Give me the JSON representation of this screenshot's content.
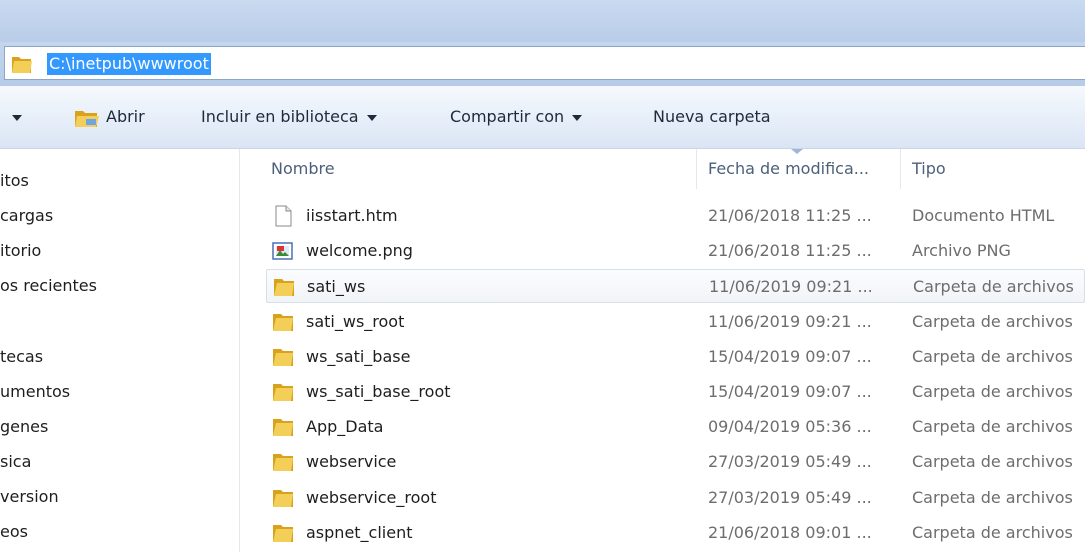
{
  "address": {
    "path": "C:\\inetpub\\wwwroot"
  },
  "toolbar": {
    "open_label": "Abrir",
    "include_label": "Incluir en biblioteca",
    "share_label": "Compartir con",
    "new_folder_label": "Nueva carpeta"
  },
  "nav": {
    "items": [
      "itos",
      "cargas",
      "itorio",
      "os recientes",
      "tecas",
      "umentos",
      "genes",
      "sica",
      "version",
      "eos"
    ]
  },
  "columns": {
    "name": "Nombre",
    "date": "Fecha de modifica...",
    "type": "Tipo"
  },
  "files": [
    {
      "icon": "document-icon",
      "name": "iisstart.htm",
      "date": "21/06/2018 11:25 ...",
      "type": "Documento HTML"
    },
    {
      "icon": "image-icon",
      "name": "welcome.png",
      "date": "21/06/2018 11:25 ...",
      "type": "Archivo PNG"
    },
    {
      "icon": "folder-icon",
      "name": "sati_ws",
      "date": "11/06/2019 09:21 ...",
      "type": "Carpeta de archivos"
    },
    {
      "icon": "folder-icon",
      "name": "sati_ws_root",
      "date": "11/06/2019 09:21 ...",
      "type": "Carpeta de archivos"
    },
    {
      "icon": "folder-icon",
      "name": "ws_sati_base",
      "date": "15/04/2019 09:07 ...",
      "type": "Carpeta de archivos"
    },
    {
      "icon": "folder-icon",
      "name": "ws_sati_base_root",
      "date": "15/04/2019 09:07 ...",
      "type": "Carpeta de archivos"
    },
    {
      "icon": "folder-icon",
      "name": "App_Data",
      "date": "09/04/2019 05:36 ...",
      "type": "Carpeta de archivos"
    },
    {
      "icon": "folder-icon",
      "name": "webservice",
      "date": "27/03/2019 05:49 ...",
      "type": "Carpeta de archivos"
    },
    {
      "icon": "folder-icon",
      "name": "webservice_root",
      "date": "27/03/2019 05:49 ...",
      "type": "Carpeta de archivos"
    },
    {
      "icon": "folder-icon",
      "name": "aspnet_client",
      "date": "21/06/2018 09:01 ...",
      "type": "Carpeta de archivos"
    }
  ],
  "colors": {
    "selection": "#3399ff",
    "folder": "#e8b931",
    "header_text": "#4c607a"
  }
}
